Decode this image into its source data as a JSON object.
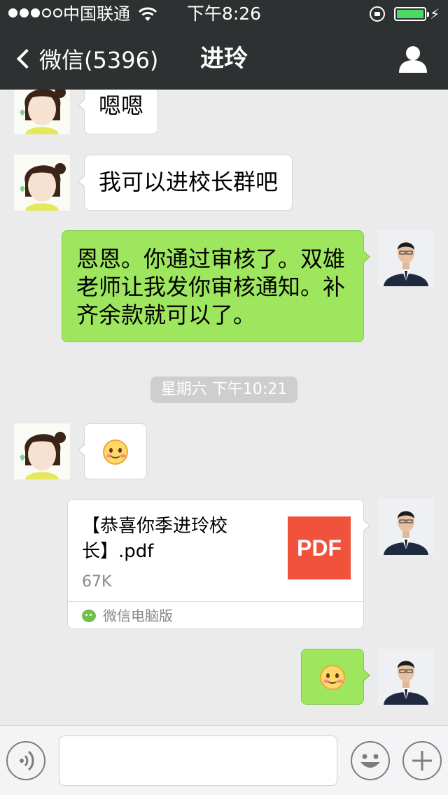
{
  "status_bar": {
    "carrier": "中国联通",
    "time": "下午8:26"
  },
  "nav": {
    "back_label": "微信(5396)",
    "title": "进玲"
  },
  "messages": [
    {
      "direction": "in",
      "type": "text",
      "text": "嗯嗯"
    },
    {
      "direction": "in",
      "type": "text",
      "text": "我可以进校长群吧"
    },
    {
      "direction": "out",
      "type": "text",
      "text": "恩恩。你通过审核了。双雄老师让我发你审核通知。补齐余款就可以了。"
    },
    {
      "direction": "in",
      "type": "emoji",
      "emoji": "smiling-face"
    },
    {
      "direction": "out",
      "type": "file",
      "file_name": "【恭喜你季进玲校长】.pdf",
      "file_size": "67K",
      "file_type": "PDF",
      "source": "微信电脑版"
    },
    {
      "direction": "out",
      "type": "emoji",
      "emoji": "smiling-face"
    }
  ],
  "timestamp": "星期六 下午10:21",
  "input": {
    "value": "",
    "placeholder": ""
  },
  "colors": {
    "header_bg": "#2e3132",
    "chat_bg": "#ebebeb",
    "outgoing_bubble": "#9ee65e",
    "pdf_badge": "#f0523c",
    "battery": "#4cd964"
  }
}
